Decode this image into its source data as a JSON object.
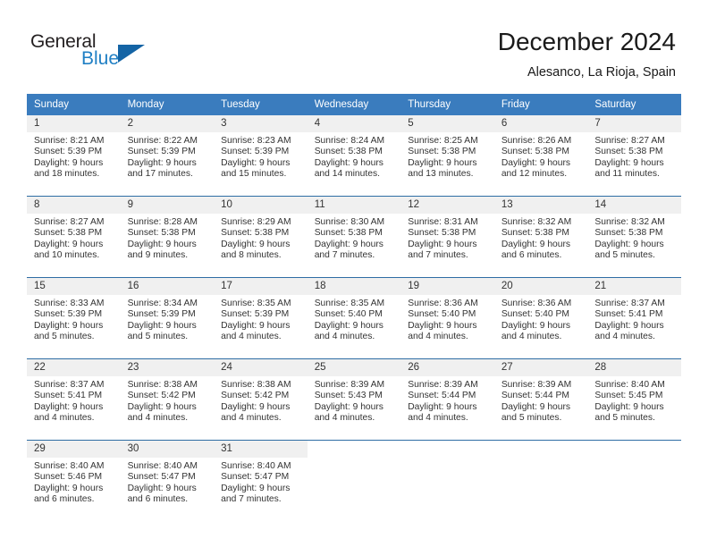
{
  "logo": {
    "word1": "General",
    "word2": "Blue"
  },
  "header": {
    "title": "December 2024",
    "subtitle": "Alesanco, La Rioja, Spain"
  },
  "weekday_headers": [
    "Sunday",
    "Monday",
    "Tuesday",
    "Wednesday",
    "Thursday",
    "Friday",
    "Saturday"
  ],
  "colors": {
    "header_blue": "#3a7cbe",
    "row_divider_blue": "#2e6da4",
    "daynum_band": "#f0f0f0",
    "logo_blue": "#1f7fc4",
    "logo_triangle": "#1464a5",
    "text": "#333333"
  },
  "weeks": [
    [
      {
        "day": "1",
        "sunrise": "Sunrise: 8:21 AM",
        "sunset": "Sunset: 5:39 PM",
        "daylight1": "Daylight: 9 hours",
        "daylight2": "and 18 minutes."
      },
      {
        "day": "2",
        "sunrise": "Sunrise: 8:22 AM",
        "sunset": "Sunset: 5:39 PM",
        "daylight1": "Daylight: 9 hours",
        "daylight2": "and 17 minutes."
      },
      {
        "day": "3",
        "sunrise": "Sunrise: 8:23 AM",
        "sunset": "Sunset: 5:39 PM",
        "daylight1": "Daylight: 9 hours",
        "daylight2": "and 15 minutes."
      },
      {
        "day": "4",
        "sunrise": "Sunrise: 8:24 AM",
        "sunset": "Sunset: 5:38 PM",
        "daylight1": "Daylight: 9 hours",
        "daylight2": "and 14 minutes."
      },
      {
        "day": "5",
        "sunrise": "Sunrise: 8:25 AM",
        "sunset": "Sunset: 5:38 PM",
        "daylight1": "Daylight: 9 hours",
        "daylight2": "and 13 minutes."
      },
      {
        "day": "6",
        "sunrise": "Sunrise: 8:26 AM",
        "sunset": "Sunset: 5:38 PM",
        "daylight1": "Daylight: 9 hours",
        "daylight2": "and 12 minutes."
      },
      {
        "day": "7",
        "sunrise": "Sunrise: 8:27 AM",
        "sunset": "Sunset: 5:38 PM",
        "daylight1": "Daylight: 9 hours",
        "daylight2": "and 11 minutes."
      }
    ],
    [
      {
        "day": "8",
        "sunrise": "Sunrise: 8:27 AM",
        "sunset": "Sunset: 5:38 PM",
        "daylight1": "Daylight: 9 hours",
        "daylight2": "and 10 minutes."
      },
      {
        "day": "9",
        "sunrise": "Sunrise: 8:28 AM",
        "sunset": "Sunset: 5:38 PM",
        "daylight1": "Daylight: 9 hours",
        "daylight2": "and 9 minutes."
      },
      {
        "day": "10",
        "sunrise": "Sunrise: 8:29 AM",
        "sunset": "Sunset: 5:38 PM",
        "daylight1": "Daylight: 9 hours",
        "daylight2": "and 8 minutes."
      },
      {
        "day": "11",
        "sunrise": "Sunrise: 8:30 AM",
        "sunset": "Sunset: 5:38 PM",
        "daylight1": "Daylight: 9 hours",
        "daylight2": "and 7 minutes."
      },
      {
        "day": "12",
        "sunrise": "Sunrise: 8:31 AM",
        "sunset": "Sunset: 5:38 PM",
        "daylight1": "Daylight: 9 hours",
        "daylight2": "and 7 minutes."
      },
      {
        "day": "13",
        "sunrise": "Sunrise: 8:32 AM",
        "sunset": "Sunset: 5:38 PM",
        "daylight1": "Daylight: 9 hours",
        "daylight2": "and 6 minutes."
      },
      {
        "day": "14",
        "sunrise": "Sunrise: 8:32 AM",
        "sunset": "Sunset: 5:38 PM",
        "daylight1": "Daylight: 9 hours",
        "daylight2": "and 5 minutes."
      }
    ],
    [
      {
        "day": "15",
        "sunrise": "Sunrise: 8:33 AM",
        "sunset": "Sunset: 5:39 PM",
        "daylight1": "Daylight: 9 hours",
        "daylight2": "and 5 minutes."
      },
      {
        "day": "16",
        "sunrise": "Sunrise: 8:34 AM",
        "sunset": "Sunset: 5:39 PM",
        "daylight1": "Daylight: 9 hours",
        "daylight2": "and 5 minutes."
      },
      {
        "day": "17",
        "sunrise": "Sunrise: 8:35 AM",
        "sunset": "Sunset: 5:39 PM",
        "daylight1": "Daylight: 9 hours",
        "daylight2": "and 4 minutes."
      },
      {
        "day": "18",
        "sunrise": "Sunrise: 8:35 AM",
        "sunset": "Sunset: 5:40 PM",
        "daylight1": "Daylight: 9 hours",
        "daylight2": "and 4 minutes."
      },
      {
        "day": "19",
        "sunrise": "Sunrise: 8:36 AM",
        "sunset": "Sunset: 5:40 PM",
        "daylight1": "Daylight: 9 hours",
        "daylight2": "and 4 minutes."
      },
      {
        "day": "20",
        "sunrise": "Sunrise: 8:36 AM",
        "sunset": "Sunset: 5:40 PM",
        "daylight1": "Daylight: 9 hours",
        "daylight2": "and 4 minutes."
      },
      {
        "day": "21",
        "sunrise": "Sunrise: 8:37 AM",
        "sunset": "Sunset: 5:41 PM",
        "daylight1": "Daylight: 9 hours",
        "daylight2": "and 4 minutes."
      }
    ],
    [
      {
        "day": "22",
        "sunrise": "Sunrise: 8:37 AM",
        "sunset": "Sunset: 5:41 PM",
        "daylight1": "Daylight: 9 hours",
        "daylight2": "and 4 minutes."
      },
      {
        "day": "23",
        "sunrise": "Sunrise: 8:38 AM",
        "sunset": "Sunset: 5:42 PM",
        "daylight1": "Daylight: 9 hours",
        "daylight2": "and 4 minutes."
      },
      {
        "day": "24",
        "sunrise": "Sunrise: 8:38 AM",
        "sunset": "Sunset: 5:42 PM",
        "daylight1": "Daylight: 9 hours",
        "daylight2": "and 4 minutes."
      },
      {
        "day": "25",
        "sunrise": "Sunrise: 8:39 AM",
        "sunset": "Sunset: 5:43 PM",
        "daylight1": "Daylight: 9 hours",
        "daylight2": "and 4 minutes."
      },
      {
        "day": "26",
        "sunrise": "Sunrise: 8:39 AM",
        "sunset": "Sunset: 5:44 PM",
        "daylight1": "Daylight: 9 hours",
        "daylight2": "and 4 minutes."
      },
      {
        "day": "27",
        "sunrise": "Sunrise: 8:39 AM",
        "sunset": "Sunset: 5:44 PM",
        "daylight1": "Daylight: 9 hours",
        "daylight2": "and 5 minutes."
      },
      {
        "day": "28",
        "sunrise": "Sunrise: 8:40 AM",
        "sunset": "Sunset: 5:45 PM",
        "daylight1": "Daylight: 9 hours",
        "daylight2": "and 5 minutes."
      }
    ],
    [
      {
        "day": "29",
        "sunrise": "Sunrise: 8:40 AM",
        "sunset": "Sunset: 5:46 PM",
        "daylight1": "Daylight: 9 hours",
        "daylight2": "and 6 minutes."
      },
      {
        "day": "30",
        "sunrise": "Sunrise: 8:40 AM",
        "sunset": "Sunset: 5:47 PM",
        "daylight1": "Daylight: 9 hours",
        "daylight2": "and 6 minutes."
      },
      {
        "day": "31",
        "sunrise": "Sunrise: 8:40 AM",
        "sunset": "Sunset: 5:47 PM",
        "daylight1": "Daylight: 9 hours",
        "daylight2": "and 7 minutes."
      },
      {
        "day": "",
        "sunrise": "",
        "sunset": "",
        "daylight1": "",
        "daylight2": ""
      },
      {
        "day": "",
        "sunrise": "",
        "sunset": "",
        "daylight1": "",
        "daylight2": ""
      },
      {
        "day": "",
        "sunrise": "",
        "sunset": "",
        "daylight1": "",
        "daylight2": ""
      },
      {
        "day": "",
        "sunrise": "",
        "sunset": "",
        "daylight1": "",
        "daylight2": ""
      }
    ]
  ]
}
